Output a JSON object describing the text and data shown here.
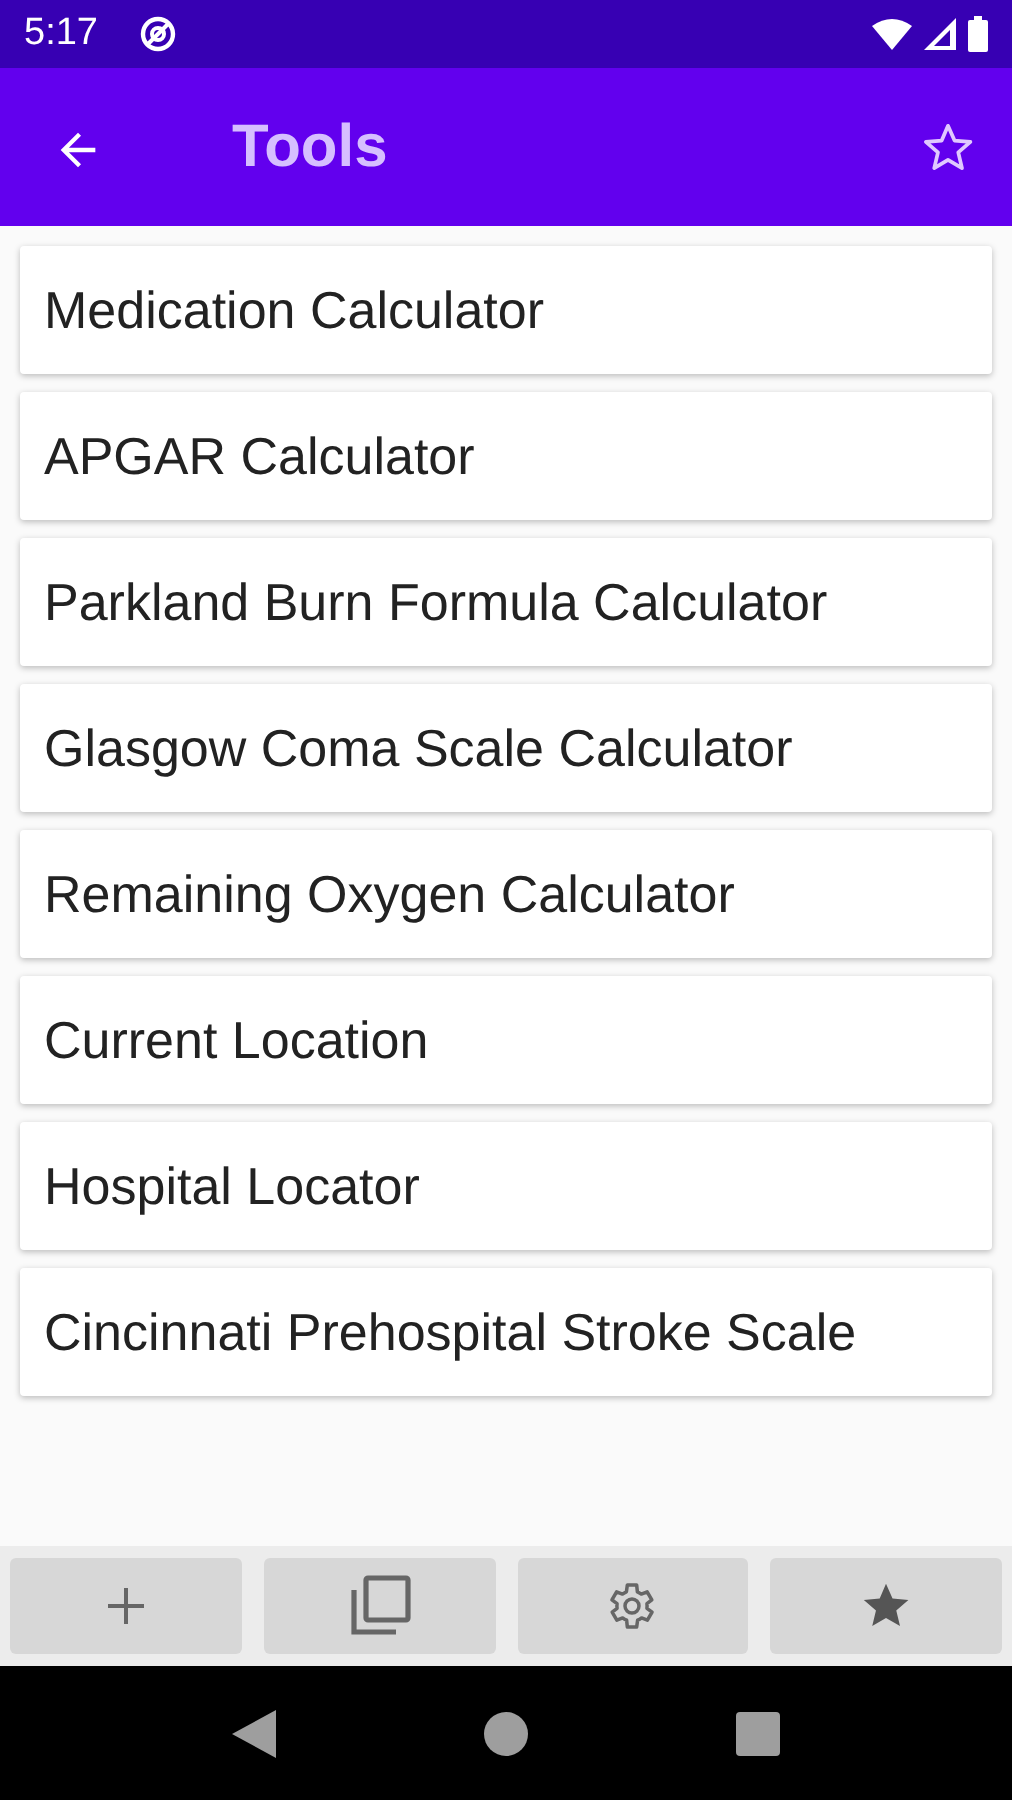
{
  "status_bar": {
    "time": "5:17"
  },
  "app_bar": {
    "title": "Tools"
  },
  "tools": [
    {
      "label": "Medication Calculator"
    },
    {
      "label": "APGAR Calculator"
    },
    {
      "label": "Parkland Burn Formula Calculator"
    },
    {
      "label": "Glasgow Coma Scale Calculator"
    },
    {
      "label": "Remaining Oxygen Calculator"
    },
    {
      "label": "Current Location"
    },
    {
      "label": "Hospital Locator"
    },
    {
      "label": "Cincinnati Prehospital Stroke Scale"
    }
  ],
  "bottom_bar": [
    {
      "kind": "add"
    },
    {
      "kind": "copy"
    },
    {
      "kind": "settings"
    },
    {
      "kind": "favorites"
    }
  ]
}
